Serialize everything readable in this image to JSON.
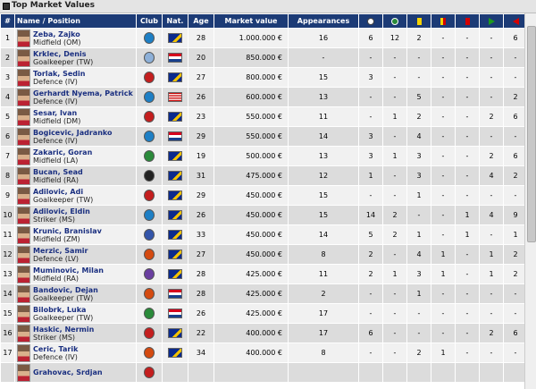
{
  "header": {
    "title": "Top Market Values"
  },
  "columns": {
    "num": "#",
    "name": "Name / Position",
    "club": "Club",
    "nat": "Nat.",
    "age": "Age",
    "value": "Market value",
    "apps": "Appearances",
    "goals": "goals-icon",
    "assists": "assists-icon",
    "yellow": "yellow-card-icon",
    "yellowred": "yellow-red-card-icon",
    "red": "red-card-icon",
    "subin": "sub-in-icon",
    "subout": "sub-out-icon"
  },
  "players": [
    {
      "num": "1",
      "name": "Zeba, Zajko",
      "position": "Midfield (OM)",
      "nat": "ba",
      "age": "28",
      "value": "1.000.000 €",
      "apps": "16",
      "goals": "6",
      "assists": "12",
      "yellow": "2",
      "yellowred": "-",
      "red": "-",
      "subin": "-",
      "subout": "6",
      "club_color": "#1d7fc5"
    },
    {
      "num": "2",
      "name": "Krklec, Denis",
      "position": "Goalkeeper (TW)",
      "nat": "hr",
      "age": "20",
      "value": "850.000 €",
      "apps": "-",
      "goals": "-",
      "assists": "-",
      "yellow": "-",
      "yellowred": "-",
      "red": "-",
      "subin": "-",
      "subout": "-",
      "club_color": "#8db0d8"
    },
    {
      "num": "3",
      "name": "Torlak, Sedin",
      "position": "Defence (IV)",
      "nat": "ba",
      "age": "27",
      "value": "800.000 €",
      "apps": "15",
      "goals": "3",
      "assists": "-",
      "yellow": "-",
      "yellowred": "-",
      "red": "-",
      "subin": "-",
      "subout": "-",
      "club_color": "#c41e1e"
    },
    {
      "num": "4",
      "name": "Gerhardt Nyema, Patrick",
      "position": "Defence (IV)",
      "nat": "us",
      "age": "26",
      "value": "600.000 €",
      "apps": "13",
      "goals": "-",
      "assists": "-",
      "yellow": "5",
      "yellowred": "-",
      "red": "-",
      "subin": "-",
      "subout": "2",
      "club_color": "#1d7fc5"
    },
    {
      "num": "5",
      "name": "Sesar, Ivan",
      "position": "Midfield (DM)",
      "nat": "ba",
      "age": "23",
      "value": "550.000 €",
      "apps": "11",
      "goals": "-",
      "assists": "1",
      "yellow": "2",
      "yellowred": "-",
      "red": "-",
      "subin": "2",
      "subout": "6",
      "club_color": "#c41e1e"
    },
    {
      "num": "6",
      "name": "Bogicevic, Jadranko",
      "position": "Defence (IV)",
      "nat": "hr",
      "age": "29",
      "value": "550.000 €",
      "apps": "14",
      "goals": "3",
      "assists": "-",
      "yellow": "4",
      "yellowred": "-",
      "red": "-",
      "subin": "-",
      "subout": "-",
      "club_color": "#1d7fc5"
    },
    {
      "num": "7",
      "name": "Zakaric, Goran",
      "position": "Midfield (LA)",
      "nat": "ba",
      "age": "19",
      "value": "500.000 €",
      "apps": "13",
      "goals": "3",
      "assists": "1",
      "yellow": "3",
      "yellowred": "-",
      "red": "-",
      "subin": "2",
      "subout": "6",
      "club_color": "#2a8a3a"
    },
    {
      "num": "8",
      "name": "Bucan, Sead",
      "position": "Midfield (RA)",
      "nat": "ba",
      "age": "31",
      "value": "475.000 €",
      "apps": "12",
      "goals": "1",
      "assists": "-",
      "yellow": "3",
      "yellowred": "-",
      "red": "-",
      "subin": "4",
      "subout": "2",
      "club_color": "#222222"
    },
    {
      "num": "9",
      "name": "Adilovic, Adi",
      "position": "Goalkeeper (TW)",
      "nat": "ba",
      "age": "29",
      "value": "450.000 €",
      "apps": "15",
      "goals": "-",
      "assists": "-",
      "yellow": "1",
      "yellowred": "-",
      "red": "-",
      "subin": "-",
      "subout": "-",
      "club_color": "#c41e1e"
    },
    {
      "num": "10",
      "name": "Adilovic, Eldin",
      "position": "Striker (MS)",
      "nat": "ba",
      "age": "26",
      "value": "450.000 €",
      "apps": "15",
      "goals": "14",
      "assists": "2",
      "yellow": "-",
      "yellowred": "-",
      "red": "1",
      "subin": "4",
      "subout": "9",
      "club_color": "#1d7fc5"
    },
    {
      "num": "11",
      "name": "Krunic, Branislav",
      "position": "Midfield (ZM)",
      "nat": "ba",
      "age": "33",
      "value": "450.000 €",
      "apps": "14",
      "goals": "5",
      "assists": "2",
      "yellow": "1",
      "yellowred": "-",
      "red": "1",
      "subin": "-",
      "subout": "1",
      "club_color": "#3355aa"
    },
    {
      "num": "12",
      "name": "Merzic, Samir",
      "position": "Defence (LV)",
      "nat": "ba",
      "age": "27",
      "value": "450.000 €",
      "apps": "8",
      "goals": "2",
      "assists": "-",
      "yellow": "4",
      "yellowred": "1",
      "red": "-",
      "subin": "1",
      "subout": "2",
      "club_color": "#d44a10"
    },
    {
      "num": "13",
      "name": "Muminovic, Milan",
      "position": "Midfield (RA)",
      "nat": "ba",
      "age": "28",
      "value": "425.000 €",
      "apps": "11",
      "goals": "2",
      "assists": "1",
      "yellow": "3",
      "yellowred": "1",
      "red": "-",
      "subin": "1",
      "subout": "2",
      "club_color": "#6a3fa0"
    },
    {
      "num": "14",
      "name": "Bandovic, Dejan",
      "position": "Goalkeeper (TW)",
      "nat": "hr",
      "age": "28",
      "value": "425.000 €",
      "apps": "2",
      "goals": "-",
      "assists": "-",
      "yellow": "1",
      "yellowred": "-",
      "red": "-",
      "subin": "-",
      "subout": "-",
      "club_color": "#d44a10"
    },
    {
      "num": "15",
      "name": "Bilobrk, Luka",
      "position": "Goalkeeper (TW)",
      "nat": "hr",
      "age": "26",
      "value": "425.000 €",
      "apps": "17",
      "goals": "-",
      "assists": "-",
      "yellow": "-",
      "yellowred": "-",
      "red": "-",
      "subin": "-",
      "subout": "-",
      "club_color": "#2a8a3a"
    },
    {
      "num": "16",
      "name": "Haskic, Nermin",
      "position": "Striker (MS)",
      "nat": "ba",
      "age": "22",
      "value": "400.000 €",
      "apps": "17",
      "goals": "6",
      "assists": "-",
      "yellow": "-",
      "yellowred": "-",
      "red": "-",
      "subin": "2",
      "subout": "6",
      "club_color": "#c41e1e"
    },
    {
      "num": "17",
      "name": "Ceric, Tarik",
      "position": "Defence (IV)",
      "nat": "ba",
      "age": "34",
      "value": "400.000 €",
      "apps": "8",
      "goals": "-",
      "assists": "-",
      "yellow": "2",
      "yellowred": "1",
      "red": "-",
      "subin": "-",
      "subout": "-",
      "club_color": "#d44a10"
    },
    {
      "num": "",
      "name": "Grahovac, Srdjan",
      "position": "",
      "nat": "",
      "age": "",
      "value": "",
      "apps": "",
      "goals": "",
      "assists": "",
      "yellow": "",
      "yellowred": "",
      "red": "",
      "subin": "",
      "subout": "",
      "club_color": "#c41e1e"
    }
  ]
}
